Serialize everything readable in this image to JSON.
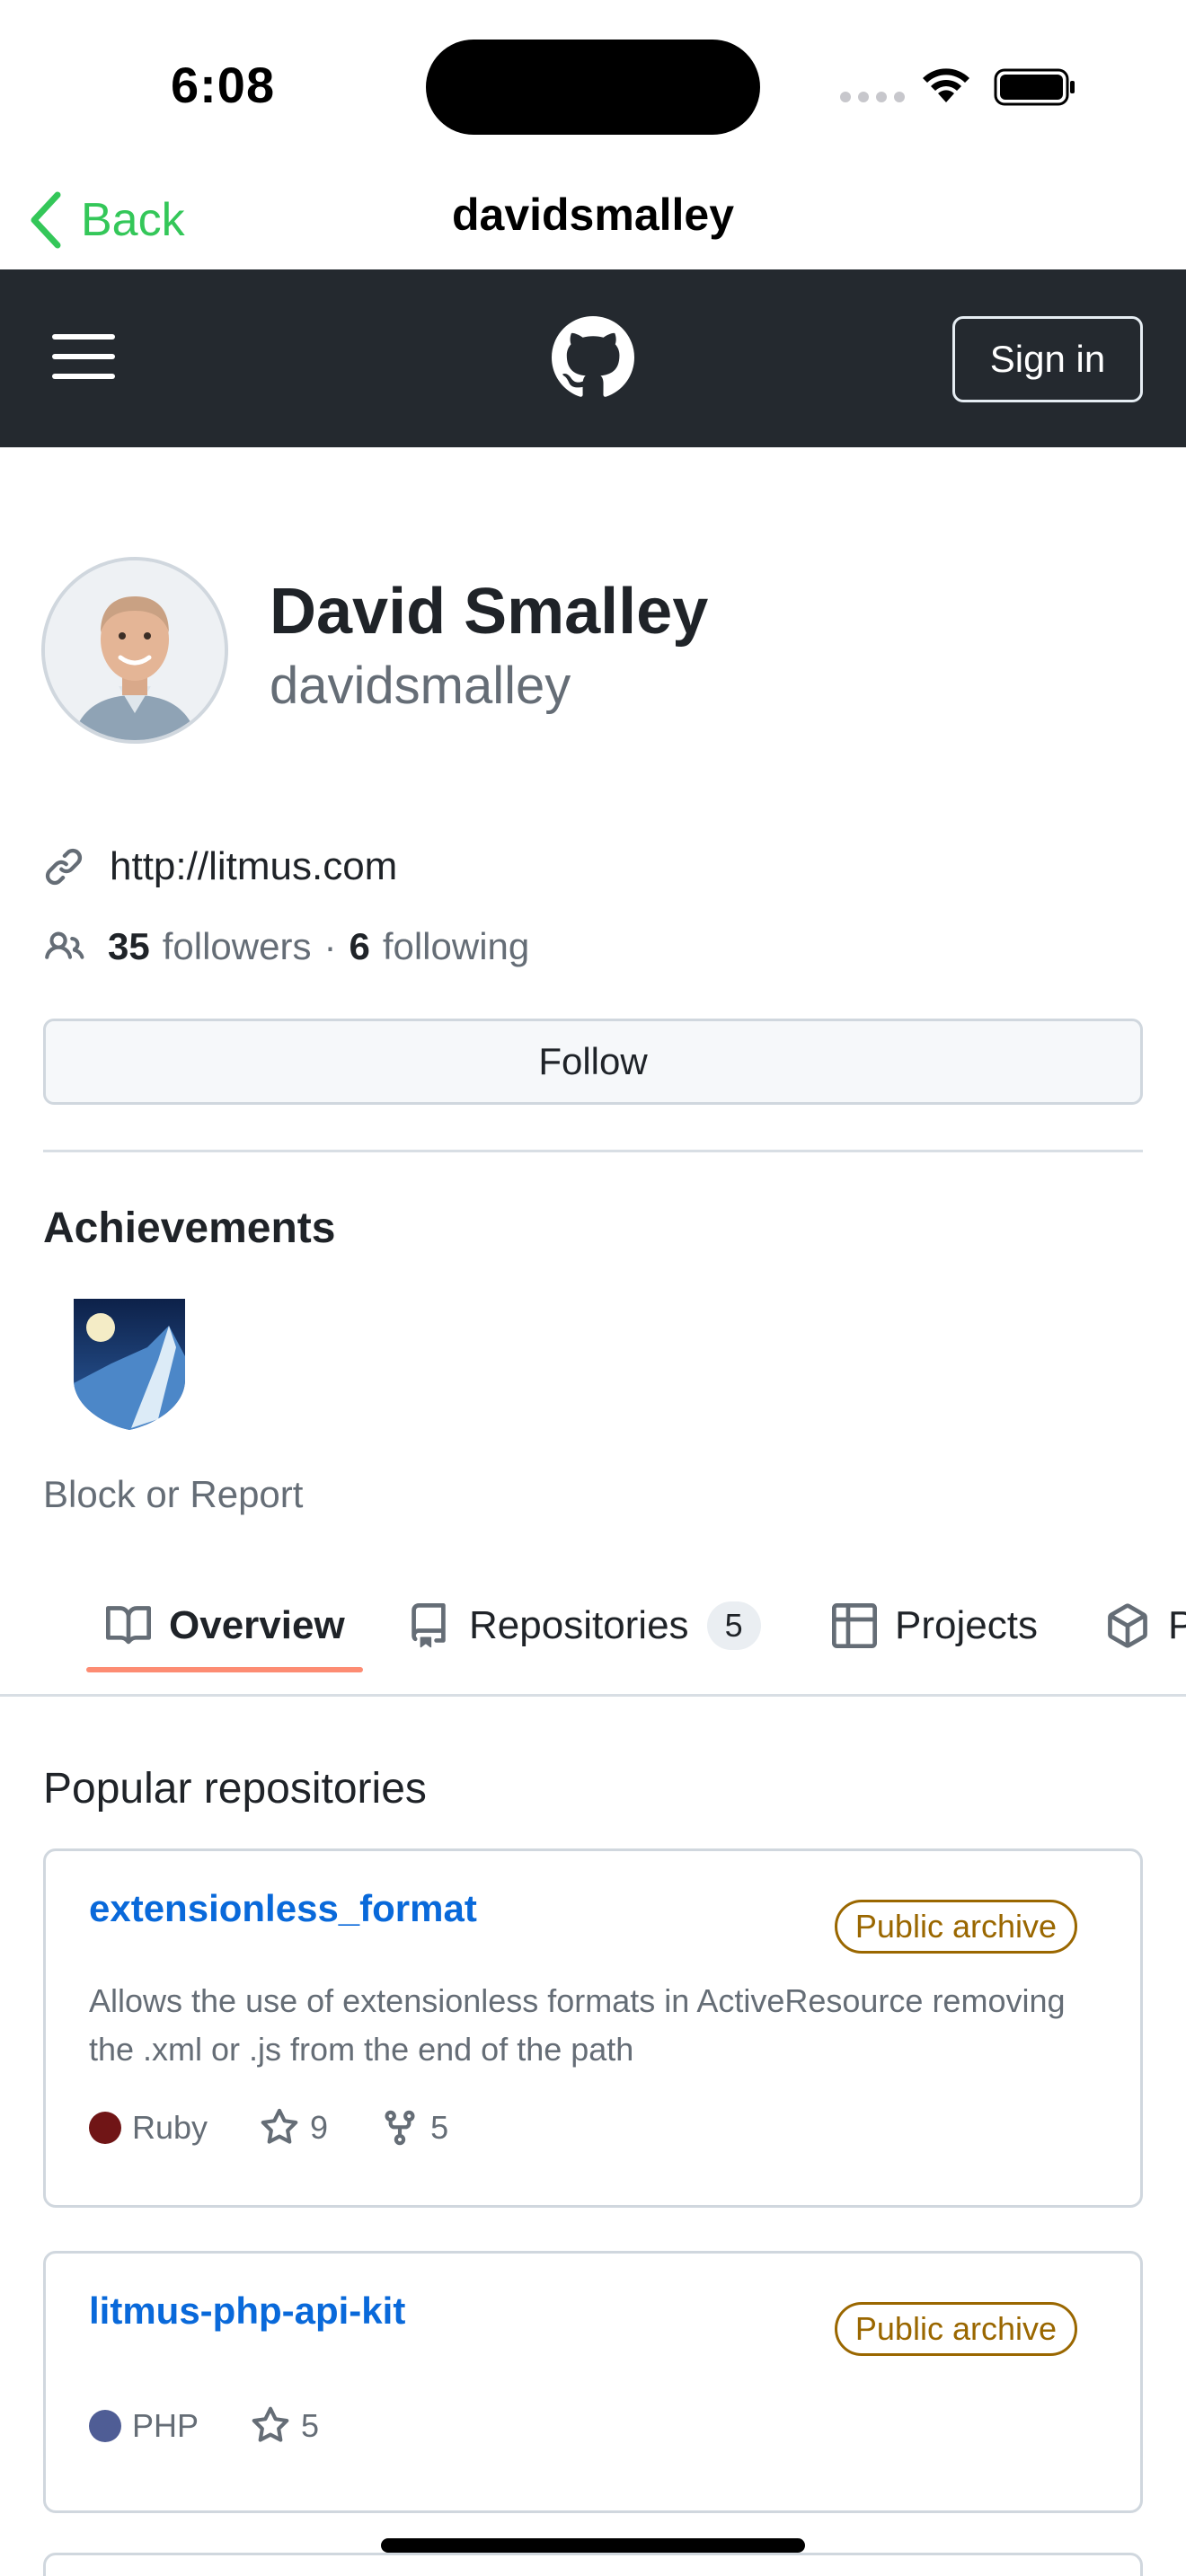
{
  "status_bar": {
    "time": "6:08"
  },
  "nav": {
    "back_label": "Back",
    "title": "davidsmalley"
  },
  "header": {
    "signin_label": "Sign in",
    "logo_icon": "github-mark-icon",
    "menu_icon": "hamburger-icon"
  },
  "profile": {
    "name": "David Smalley",
    "login": "davidsmalley",
    "website": "http://litmus.com",
    "followers_count": "35",
    "followers_label": "followers",
    "separator": "·",
    "following_count": "6",
    "following_label": "following",
    "follow_button": "Follow"
  },
  "achievements": {
    "title": "Achievements"
  },
  "block_report": "Block or Report",
  "tabs": [
    {
      "label": "Overview",
      "icon": "book-icon",
      "selected": true
    },
    {
      "label": "Repositories",
      "icon": "repo-icon",
      "count": "5"
    },
    {
      "label": "Projects",
      "icon": "table-icon"
    },
    {
      "label": "P",
      "icon": "package-icon"
    }
  ],
  "popular": {
    "title": "Popular repositories",
    "repos": [
      {
        "name": "extensionless_format",
        "badge": "Public archive",
        "description": "Allows the use of extensionless formats in ActiveResource removing the .xml or .js from the end of the path",
        "language": "Ruby",
        "language_color": "#701516",
        "stars": "9",
        "forks": "5"
      },
      {
        "name": "litmus-php-api-kit",
        "badge": "Public archive",
        "language": "PHP",
        "language_color": "#4F5D95",
        "stars": "5"
      }
    ]
  },
  "colors": {
    "accent_link": "#0969da",
    "tab_underline": "#fd8c73",
    "header_bg": "#24292f",
    "ios_green": "#34c759",
    "archive": "#9a6700"
  }
}
